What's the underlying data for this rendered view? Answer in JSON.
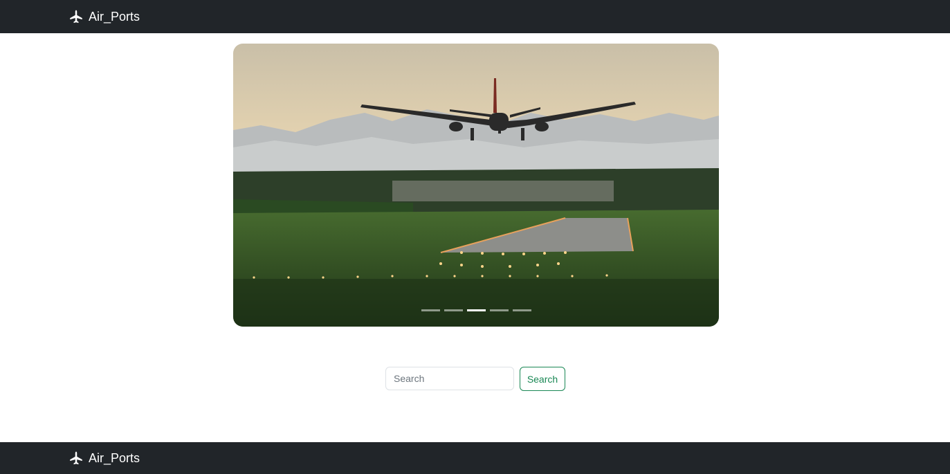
{
  "navbar": {
    "brand_label": "Air_Ports",
    "brand_icon": "airplane-icon"
  },
  "carousel": {
    "slide_count": 5,
    "active_index": 2
  },
  "search": {
    "placeholder": "Search",
    "button_label": "Search"
  },
  "footer": {
    "brand_label": "Air_Ports",
    "brand_icon": "airplane-icon"
  },
  "colors": {
    "bar_bg": "#212529",
    "accent": "#198754"
  }
}
